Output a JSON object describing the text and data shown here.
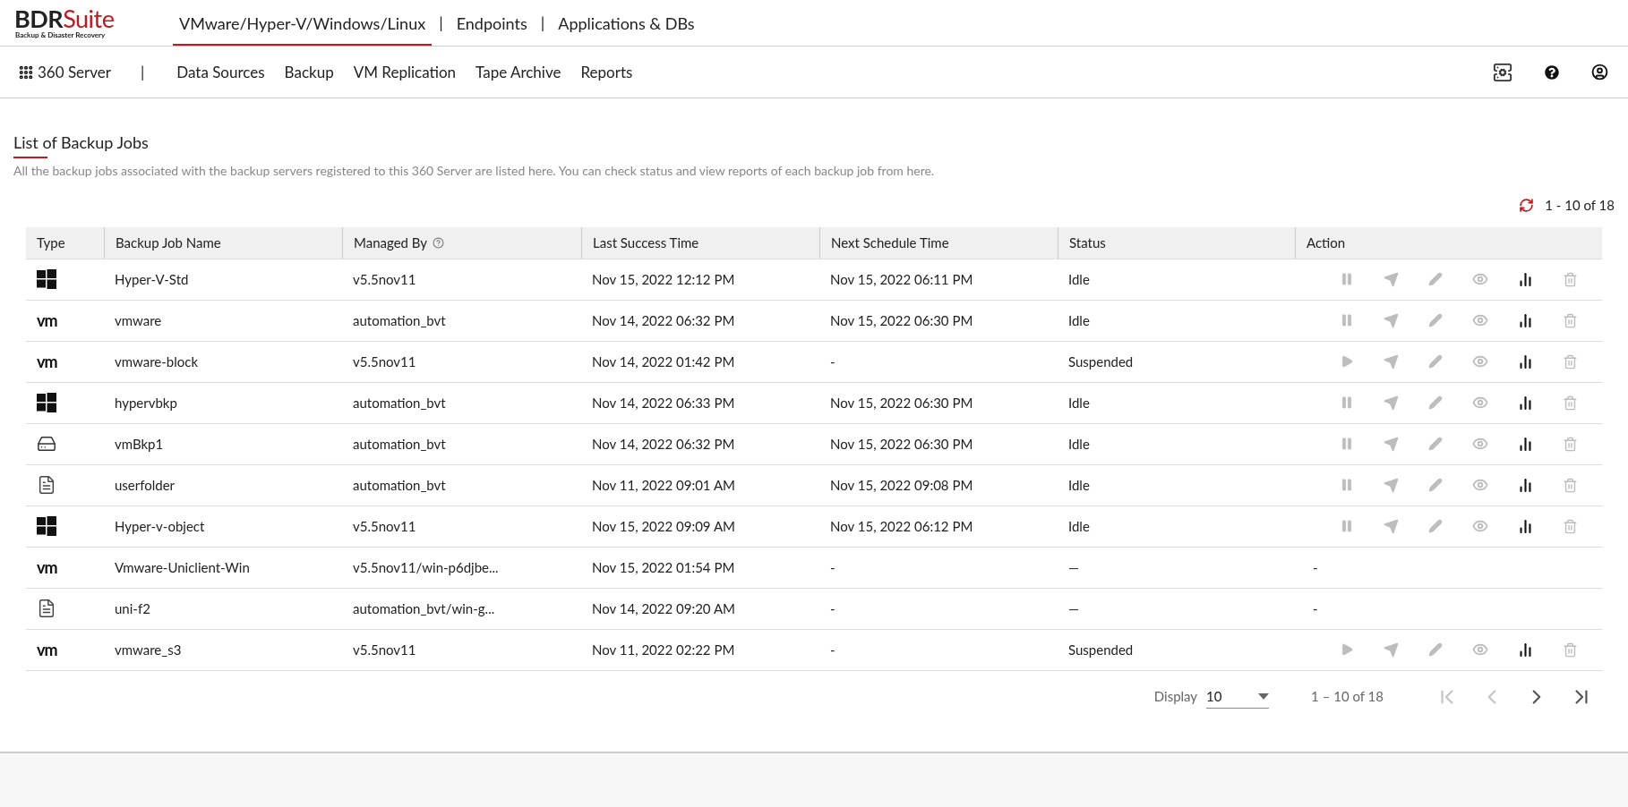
{
  "logo": {
    "brand_dark": "BDR",
    "brand_red": "Suite",
    "tagline": "Backup & Disaster Recovery"
  },
  "top_tabs": [
    {
      "label": "VMware/Hyper-V/Windows/Linux",
      "selected": true
    },
    {
      "label": "Endpoints",
      "selected": false
    },
    {
      "label": "Applications & DBs",
      "selected": false
    }
  ],
  "top_tab_separator": "|",
  "server_menu": {
    "label": "360 Server",
    "separator": "|"
  },
  "nav_items": [
    "Data Sources",
    "Backup",
    "VM Replication",
    "Tape Archive",
    "Reports"
  ],
  "page": {
    "title": "List of Backup Jobs",
    "description": "All the backup jobs associated with the backup servers registered to this 360 Server are listed here. You can check status and view reports of each backup job from here.",
    "range": "1 - 10 of 18"
  },
  "table": {
    "columns": [
      {
        "label": "Type",
        "help": false
      },
      {
        "label": "Backup Job Name",
        "help": false
      },
      {
        "label": "Managed By",
        "help": true
      },
      {
        "label": "Last Success Time",
        "help": false
      },
      {
        "label": "Next Schedule Time",
        "help": false
      },
      {
        "label": "Status",
        "help": false
      },
      {
        "label": "Action",
        "help": false
      }
    ],
    "rows": [
      {
        "type": {
          "kind": "windows"
        },
        "name": "Hyper-V-Std",
        "managed_by": "v5.5nov11",
        "last_success": "Nov 15, 2022 12:12 PM",
        "next_schedule": "Nov 15, 2022 06:11 PM",
        "status": "Idle",
        "action": {
          "kind": "pause"
        }
      },
      {
        "type": {
          "kind": "vmware",
          "text": "vm"
        },
        "name": "vmware",
        "managed_by": "automation_bvt",
        "last_success": "Nov 14, 2022 06:32 PM",
        "next_schedule": "Nov 15, 2022 06:30 PM",
        "status": "Idle",
        "action": {
          "kind": "pause"
        }
      },
      {
        "type": {
          "kind": "vmware",
          "text": "vm"
        },
        "name": "vmware-block",
        "managed_by": "v5.5nov11",
        "last_success": "Nov 14, 2022 01:42 PM",
        "next_schedule": "-",
        "status": "Suspended",
        "action": {
          "kind": "play"
        }
      },
      {
        "type": {
          "kind": "windows"
        },
        "name": "hypervbkp",
        "managed_by": "automation_bvt",
        "last_success": "Nov 14, 2022 06:33 PM",
        "next_schedule": "Nov 15, 2022 06:30 PM",
        "status": "Idle",
        "action": {
          "kind": "pause"
        }
      },
      {
        "type": {
          "kind": "drive"
        },
        "name": "vmBkp1",
        "managed_by": "automation_bvt",
        "last_success": "Nov 14, 2022 06:32 PM",
        "next_schedule": "Nov 15, 2022 06:30 PM",
        "status": "Idle",
        "action": {
          "kind": "pause"
        }
      },
      {
        "type": {
          "kind": "file"
        },
        "name": "userfolder",
        "managed_by": "automation_bvt",
        "last_success": "Nov 11, 2022 09:01 AM",
        "next_schedule": "Nov 15, 2022 09:08 PM",
        "status": "Idle",
        "action": {
          "kind": "pause"
        }
      },
      {
        "type": {
          "kind": "windows"
        },
        "name": "Hyper-v-object",
        "managed_by": "v5.5nov11",
        "last_success": "Nov 15, 2022 09:09 AM",
        "next_schedule": "Nov 15, 2022 06:12 PM",
        "status": "Idle",
        "action": {
          "kind": "pause"
        }
      },
      {
        "type": {
          "kind": "vmware",
          "text": "vm"
        },
        "name": "Vmware-Uniclient-Win",
        "managed_by": "v5.5nov11/win-p6djbe...",
        "last_success": "Nov 15, 2022 01:54 PM",
        "next_schedule": "-",
        "status": "—",
        "action": {
          "kind": "none",
          "text": "-"
        }
      },
      {
        "type": {
          "kind": "file"
        },
        "name": "uni-f2",
        "managed_by": "automation_bvt/win-g...",
        "last_success": "Nov 14, 2022 09:20 AM",
        "next_schedule": "-",
        "status": "—",
        "action": {
          "kind": "none",
          "text": "-"
        }
      },
      {
        "type": {
          "kind": "vmware",
          "text": "vm"
        },
        "name": "vmware_s3",
        "managed_by": "v5.5nov11",
        "last_success": "Nov 11, 2022 02:22 PM",
        "next_schedule": "-",
        "status": "Suspended",
        "action": {
          "kind": "play"
        }
      }
    ]
  },
  "pagination": {
    "display_label": "Display",
    "page_size": "10",
    "range": "1 – 10 of 18",
    "first_disabled": true,
    "prev_disabled": true,
    "next_disabled": false,
    "last_disabled": false
  }
}
